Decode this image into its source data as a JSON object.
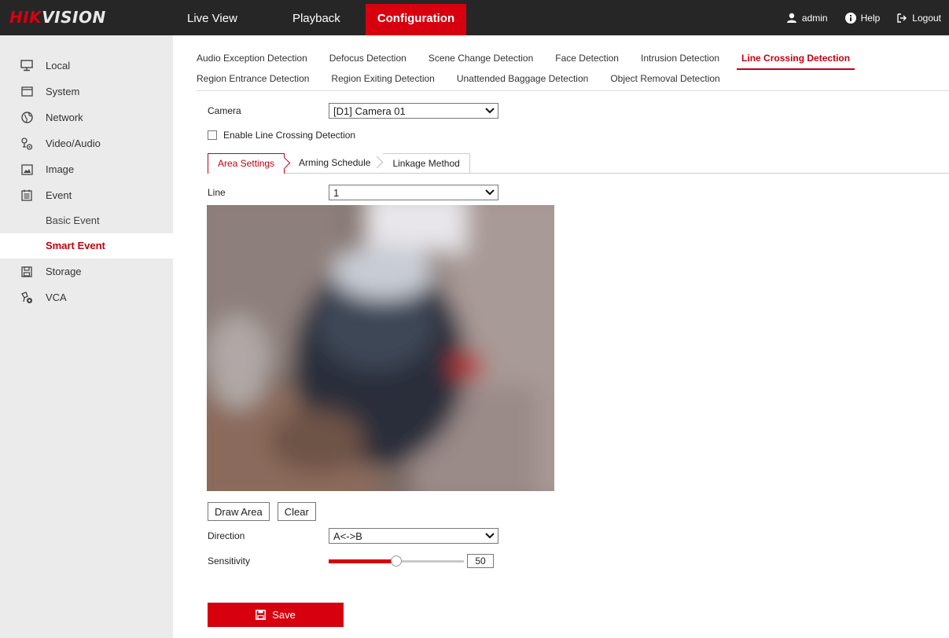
{
  "brand": {
    "logo_part1": "HIK",
    "logo_part2": "VISION",
    "accent": "#d7000f"
  },
  "topnav": {
    "live_view": "Live View",
    "playback": "Playback",
    "configuration": "Configuration"
  },
  "topright": {
    "user": "admin",
    "help": "Help",
    "logout": "Logout"
  },
  "sidebar": {
    "local": "Local",
    "system": "System",
    "network": "Network",
    "video_audio": "Video/Audio",
    "image": "Image",
    "event": "Event",
    "basic_event": "Basic Event",
    "smart_event": "Smart Event",
    "storage": "Storage",
    "vca": "VCA"
  },
  "subtabs": {
    "row1": [
      "Audio Exception Detection",
      "Defocus Detection",
      "Scene Change Detection",
      "Face Detection",
      "Intrusion Detection",
      "Line Crossing Detection"
    ],
    "row2": [
      "Region Entrance Detection",
      "Region Exiting Detection",
      "Unattended Baggage Detection",
      "Object Removal Detection"
    ],
    "active": "Line Crossing Detection"
  },
  "form": {
    "camera_label": "Camera",
    "camera_value": "[D1] Camera 01",
    "enable_label": "Enable Line Crossing Detection",
    "enable_checked": false,
    "area_tabs": [
      "Area Settings",
      "Arming Schedule",
      "Linkage Method"
    ],
    "line_label": "Line",
    "line_value": "1",
    "draw_area": "Draw Area",
    "clear": "Clear",
    "direction_label": "Direction",
    "direction_value": "A<->B",
    "sensitivity_label": "Sensitivity",
    "sensitivity_value": "50",
    "sensitivity_max": 100,
    "save": "Save"
  }
}
